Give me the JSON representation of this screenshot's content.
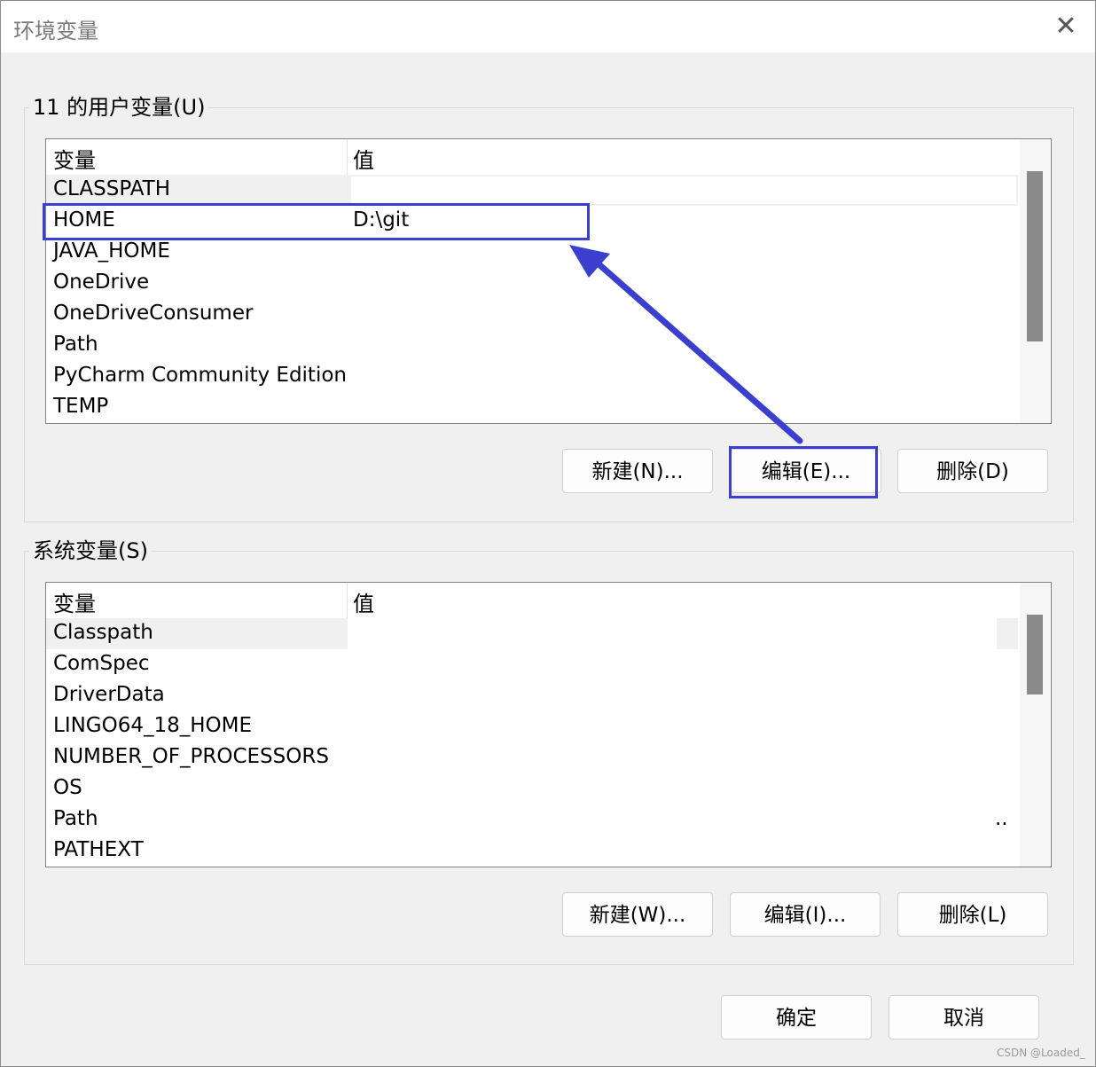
{
  "window": {
    "title": "环境变量",
    "close_glyph": "✕"
  },
  "user_vars": {
    "label": "11 的用户变量(U)",
    "headers": {
      "name": "变量",
      "value": "值"
    },
    "rows": [
      {
        "name": "CLASSPATH",
        "value": ""
      },
      {
        "name": "HOME",
        "value": "D:\\git"
      },
      {
        "name": "JAVA_HOME",
        "value": ""
      },
      {
        "name": "OneDrive",
        "value": ""
      },
      {
        "name": "OneDriveConsumer",
        "value": ""
      },
      {
        "name": "Path",
        "value": ""
      },
      {
        "name": "PyCharm Community Edition",
        "value": ""
      },
      {
        "name": "TEMP",
        "value": ""
      }
    ],
    "buttons": {
      "new": "新建(N)...",
      "edit": "编辑(E)...",
      "delete": "删除(D)"
    }
  },
  "system_vars": {
    "label": "系统变量(S)",
    "headers": {
      "name": "变量",
      "value": "值"
    },
    "rows": [
      {
        "name": "Classpath",
        "value": ""
      },
      {
        "name": "ComSpec",
        "value": ""
      },
      {
        "name": "DriverData",
        "value": ""
      },
      {
        "name": "LINGO64_18_HOME",
        "value": ""
      },
      {
        "name": "NUMBER_OF_PROCESSORS",
        "value": ""
      },
      {
        "name": "OS",
        "value": ""
      },
      {
        "name": "Path",
        "value": ".."
      },
      {
        "name": "PATHEXT",
        "value": ""
      }
    ],
    "buttons": {
      "new": "新建(W)...",
      "edit": "编辑(I)...",
      "delete": "删除(L)"
    }
  },
  "footer": {
    "ok": "确定",
    "cancel": "取消"
  },
  "watermark": "CSDN @Loaded_",
  "colors": {
    "annotation": "#3b3fcf",
    "scroll_thumb": "#8a8a8a"
  }
}
